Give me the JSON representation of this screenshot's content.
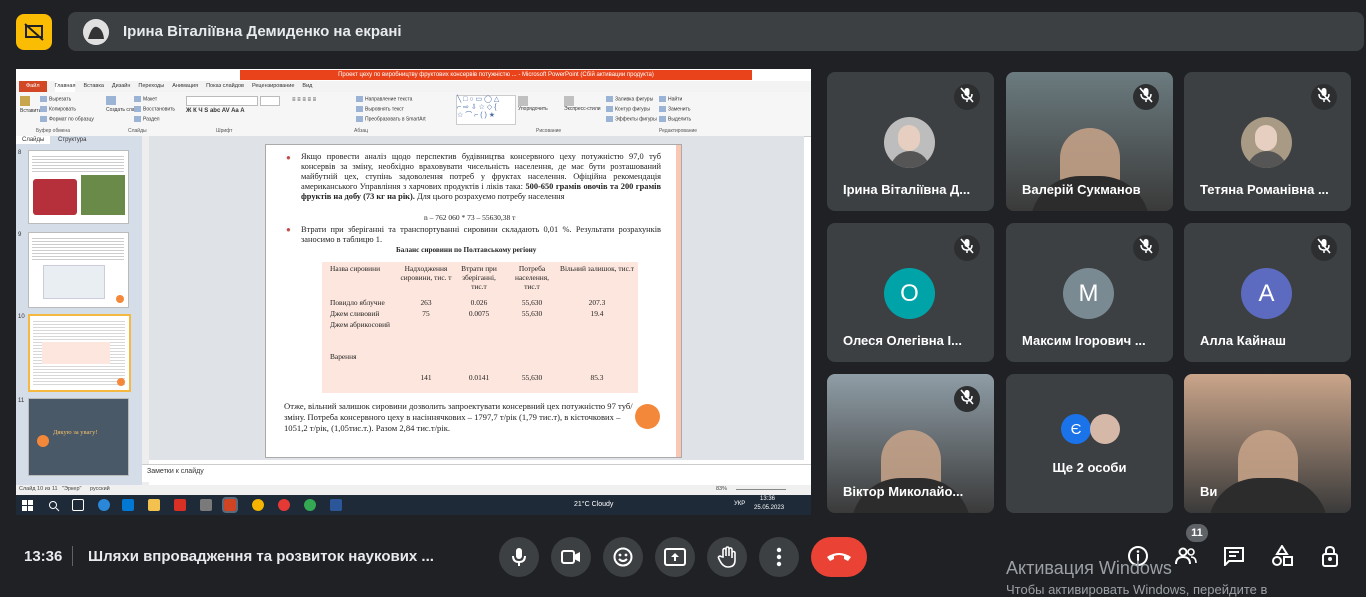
{
  "presenting": {
    "text": "Ірина Віталіївна Демиденко на екрані"
  },
  "ppt": {
    "title": "Проект цеху по виробництву фруктових консервів потужністю ... - Microsoft PowerPoint (Сбій активации продукта)",
    "tabs": [
      "Файл",
      "Главная",
      "Вставка",
      "Дизайн",
      "Переходы",
      "Анимация",
      "Показ слайдов",
      "Рецензирование",
      "Вид"
    ],
    "ribbon_groups": [
      "Буфер обмена",
      "Слайды",
      "Шрифт",
      "Абзац",
      "Рисование",
      "Редактирование"
    ],
    "ribbon_items": {
      "paste": "Вставить",
      "cut": "Вырезать",
      "copy": "Копировать",
      "format": "Формат по образцу",
      "create_slide": "Создать слайд",
      "layout": "Макет",
      "restore": "Восстановить",
      "section": "Раздел",
      "text_direction": "Направление текста",
      "align_text": "Выровнять текст",
      "convert_smartart": "Преобразовать в SmartArt",
      "arrange": "Упорядочить",
      "quick_styles": "Экспресс-стили",
      "fill": "Заливка фигуры",
      "outline": "Контур фигуры",
      "effects": "Эффекты фигуры",
      "find": "Найти",
      "replace": "Заменить",
      "select": "Выделить"
    },
    "pane_tabs": [
      "Слайды",
      "Структура"
    ],
    "thumb_numbers": [
      "8",
      "9",
      "10",
      "11"
    ],
    "thumb_end_text": "Дякую за увагу!",
    "slide": {
      "bullet1": "Якщо провести аналіз щодо перспектив будівництва консервного цеху потужністю 97,0 туб консервів за зміну, необхідно враховувати чисельність населення, де має бути розташований майбутній цех, ступінь задоволення потреб у фруктах населення. Офіційна рекомендація американського Управління з харчових продуктів і ліків така:",
      "bullet1_bold": "500-650 грамів овочів та 200 грамів фруктів на добу (73 кг на рік).",
      "bullet1_tail": "Для цього розрахуємо потребу населення",
      "formula": "n – 762 060 * 73 – 55630,38 т",
      "bullet2": "Втрати при зберіганні та транспортуванні сировини складають 0,01 %. Результати розрахунків заносимо в таблицю 1.",
      "table_title": "Баланс сировини по Полтавському регіону",
      "table_headers": [
        "Назва сировини",
        "Надходження сировини, тис. т",
        "Втрати при зберіганні, тис.т",
        "Потреба населення, тис.т",
        "Вільний залишок, тис.т"
      ],
      "table_rows": [
        [
          "Повидло яблучне",
          "263",
          "0.026",
          "55,630",
          "207.3"
        ],
        [
          "Джем сливовий",
          "75",
          "0.0075",
          "55,630",
          "19.4"
        ],
        [
          "Джем абрикосовий",
          "",
          "",
          "",
          ""
        ],
        [
          "Варення",
          "",
          "",
          "",
          ""
        ],
        [
          "",
          "141",
          "0.0141",
          "55,630",
          "85.3"
        ]
      ],
      "conclusion": "Отже, вільний залишок сировини дозволить запроектувати консервний цех потужністю 97 туб/зміну. Потреба консервного цеху в насіннячкових – 1797,7 т/рік (1,79 тис.т), в кісточкових – 1051,2 т/рік, (1,05тис.т.). Разом 2,84 тис.т/рік."
    },
    "notes_placeholder": "Заметки к слайду",
    "status": {
      "slide": "Слайд 10 из 11",
      "theme": "\"Эркер\"",
      "lang": "русский",
      "zoom": "83%"
    },
    "taskbar": {
      "weather": "21°C Cloudy",
      "lang": "УКР",
      "time": "13:36",
      "date": "25.05.2023"
    }
  },
  "participants": [
    {
      "name": "Ірина Віталіївна Д...",
      "type": "photo",
      "color": "#bdbdbd"
    },
    {
      "name": "Валерій Сукманов",
      "type": "video",
      "color": "#6b7b7f"
    },
    {
      "name": "Тетяна Романівна ...",
      "type": "photo",
      "color": "#a89a85"
    },
    {
      "name": "Олеся Олегівна І...",
      "type": "letter",
      "letter": "О",
      "color": "#00a4a8"
    },
    {
      "name": "Максим Ігорович ...",
      "type": "letter",
      "letter": "М",
      "color": "#7a8a92"
    },
    {
      "name": "Алла Кайнаш",
      "type": "letter",
      "letter": "А",
      "color": "#5c6bc0"
    },
    {
      "name": "Віктор Миколайо...",
      "type": "video",
      "color": "#8f9da6"
    },
    {
      "name": "Ще 2 особи",
      "type": "group",
      "letter": "Є",
      "color": "#1a73e8"
    },
    {
      "name": "Ви",
      "type": "video",
      "color": "#caa58a"
    }
  ],
  "bottom": {
    "time": "13:36",
    "meeting_title": "Шляхи впровадження та розвиток наукових ...",
    "participant_count": "11",
    "windows_activation": "Активация Windows",
    "windows_activation_sub": "Чтобы активировать Windows, перейдите в"
  },
  "colors": {
    "end_call": "#ea4335",
    "present_btn": "#fbbc04",
    "bg": "#202124",
    "tile": "#3c4043"
  }
}
